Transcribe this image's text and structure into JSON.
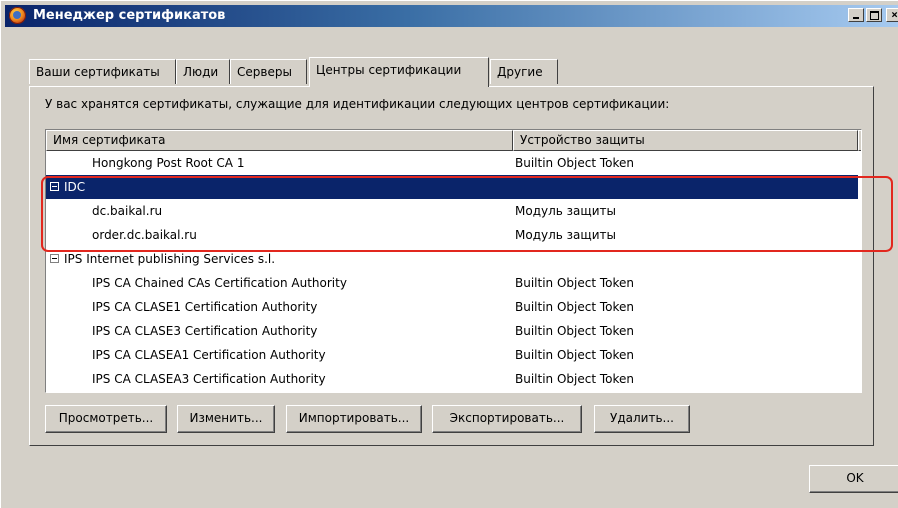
{
  "window": {
    "title": "Менеджер сертификатов"
  },
  "tabs": [
    {
      "label": "Ваши сертификаты",
      "active": false
    },
    {
      "label": "Люди",
      "active": false
    },
    {
      "label": "Серверы",
      "active": false
    },
    {
      "label": "Центры сертификации",
      "active": true
    },
    {
      "label": "Другие",
      "active": false
    }
  ],
  "description": "У вас хранятся сертификаты, служащие для идентификации следующих центров сертификации:",
  "tree": {
    "columns": [
      "Имя сертификата",
      "Устройство защиты"
    ],
    "rows": [
      {
        "name": "Hongkong Post Root CA 1",
        "device": "Builtin Object Token",
        "type": "item",
        "selected": false
      },
      {
        "name": "IDC",
        "device": "",
        "type": "group",
        "selected": true
      },
      {
        "name": "dc.baikal.ru",
        "device": "Модуль защиты",
        "type": "item",
        "selected": false
      },
      {
        "name": "order.dc.baikal.ru",
        "device": "Модуль защиты",
        "type": "item",
        "selected": false
      },
      {
        "name": "IPS Internet publishing Services s.l.",
        "device": "",
        "type": "group",
        "selected": false
      },
      {
        "name": "IPS CA Chained CAs Certification Authority",
        "device": "Builtin Object Token",
        "type": "item",
        "selected": false
      },
      {
        "name": "IPS CA CLASE1 Certification Authority",
        "device": "Builtin Object Token",
        "type": "item",
        "selected": false
      },
      {
        "name": "IPS CA CLASE3 Certification Authority",
        "device": "Builtin Object Token",
        "type": "item",
        "selected": false
      },
      {
        "name": "IPS CA CLASEA1 Certification Authority",
        "device": "Builtin Object Token",
        "type": "item",
        "selected": false
      },
      {
        "name": "IPS CA CLASEA3 Certification Authority",
        "device": "Builtin Object Token",
        "type": "item",
        "selected": false
      }
    ]
  },
  "buttons": {
    "view": "Просмотреть...",
    "edit": "Изменить...",
    "import": "Импортировать...",
    "export": "Экспортировать...",
    "delete": "Удалить...",
    "ok": "OK"
  },
  "colors": {
    "selection": "#0a246a",
    "annotation_outline": "#e2271e",
    "face": "#d4d0c8"
  }
}
